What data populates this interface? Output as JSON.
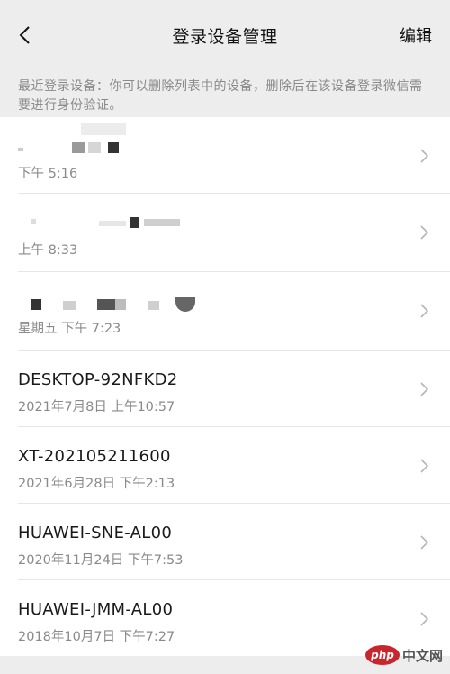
{
  "header": {
    "title": "登录设备管理",
    "edit_label": "编辑"
  },
  "hint": "最近登录设备：你可以删除列表中的设备，删除后在该设备登录微信需要进行身份验证。",
  "devices": [
    {
      "name": "",
      "time": "下午 5:16"
    },
    {
      "name": "",
      "time": "上午 8:33"
    },
    {
      "name": "",
      "time": "星期五 下午 7:23"
    },
    {
      "name": "DESKTOP-92NFKD2",
      "time": "2021年7月8日 上午10:57"
    },
    {
      "name": "XT-202105211600",
      "time": "2021年6月28日 下午2:13"
    },
    {
      "name": "HUAWEI-SNE-AL00",
      "time": "2020年11月24日 下午7:53"
    },
    {
      "name": "HUAWEI-JMM-AL00",
      "time": "2018年10月7日 下午7:27"
    }
  ],
  "watermark": {
    "logo": "php",
    "text": "中文网"
  },
  "colors": {
    "background": "#ededed",
    "list": "#ffffff",
    "secondary_text": "#8a8a8a"
  },
  "icons": {
    "back": "chevron-left-icon",
    "row": "chevron-right-icon"
  }
}
